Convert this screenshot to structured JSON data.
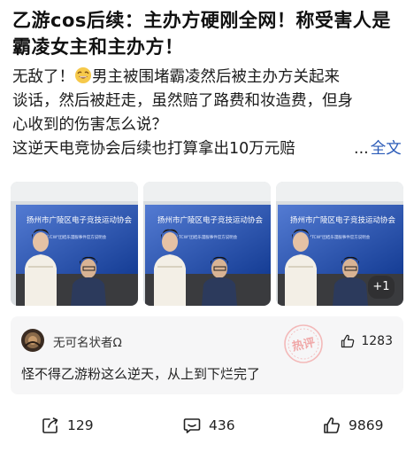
{
  "post": {
    "title": "乙游cos后续：主办方硬刚全网！称受害人是霸凌女主和主办方！",
    "body_line1_before_emoji": "无敌了！",
    "body_line1_after_emoji": "男主被围堵霸凌然后被主办方关起来",
    "body_line2": "谈话，然后被赶走，虽然赔了路费和妆造费，但身",
    "body_line3": "心收到的伤害怎么说？",
    "body_line4": "这逆天电竞协会后续也打算拿出10万元赔",
    "ellipsis": "...",
    "full_text_link": "全文",
    "emoji_icon": "grinning-face-emoji"
  },
  "images": {
    "banner_title": "扬州市广陵区电子竞技运动协会",
    "banner_subtitle": "\"TCW\"团结乐漫服事件官方说明会",
    "more_count": "+1",
    "banner_color": "#1a4fc4"
  },
  "top_comment": {
    "username": "无可名状者Ω",
    "stamp_text": "热评",
    "likes": "1283",
    "text": "怪不得乙游粉这么逆天，从上到下烂完了"
  },
  "actions": {
    "share_count": "129",
    "comment_count": "436",
    "like_count": "9869"
  }
}
